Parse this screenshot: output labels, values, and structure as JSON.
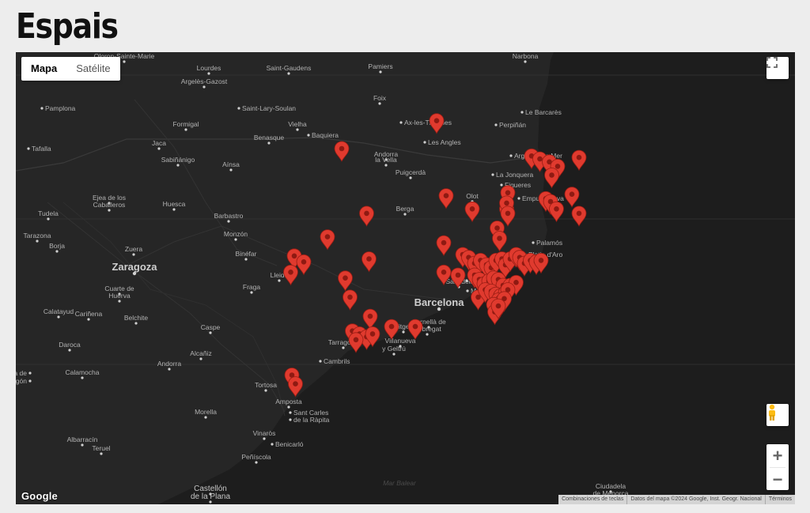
{
  "page": {
    "title": "Espais"
  },
  "map": {
    "map_type_options": [
      {
        "label": "Mapa",
        "active": true
      },
      {
        "label": "Satélite",
        "active": false
      }
    ],
    "zoom_in_label": "+",
    "zoom_out_label": "−",
    "google_logo": "Google",
    "attribution": [
      "Combinaciones de teclas",
      "Datos del mapa ©2024 Google, Inst. Geogr. Nacional",
      "Términos"
    ],
    "marker_color": "#e03a2e",
    "places": [
      {
        "name": "Oloron-Sainte-Marie",
        "type": "town"
      },
      {
        "name": "Lourdes",
        "type": "town"
      },
      {
        "name": "Saint-Gaudens",
        "type": "town"
      },
      {
        "name": "Pamiers",
        "type": "town"
      },
      {
        "name": "Narbona",
        "type": "town"
      },
      {
        "name": "Argelès-Gazost",
        "type": "town"
      },
      {
        "name": "Foix",
        "type": "town"
      },
      {
        "name": "Pamplona",
        "type": "town"
      },
      {
        "name": "Saint-Lary-Soulan",
        "type": "town"
      },
      {
        "name": "Le Barcarès",
        "type": "town"
      },
      {
        "name": "Formigal",
        "type": "town"
      },
      {
        "name": "Vielha",
        "type": "town"
      },
      {
        "name": "Ax-les-Thermes",
        "type": "town"
      },
      {
        "name": "Perpiñán",
        "type": "town"
      },
      {
        "name": "Benasque",
        "type": "town"
      },
      {
        "name": "Baquiera",
        "type": "town"
      },
      {
        "name": "Jaca",
        "type": "town"
      },
      {
        "name": "Les Angles",
        "type": "town"
      },
      {
        "name": "Tafalla",
        "type": "town"
      },
      {
        "name": "Andorra",
        "type": "town"
      },
      {
        "name": "la Vella",
        "type": "town"
      },
      {
        "name": "Argelès-sur-Mer",
        "type": "town"
      },
      {
        "name": "Sabiñánigo",
        "type": "town"
      },
      {
        "name": "Aínsa",
        "type": "town"
      },
      {
        "name": "Puigcerdà",
        "type": "town"
      },
      {
        "name": "La Jonquera",
        "type": "town"
      },
      {
        "name": "Figueres",
        "type": "town"
      },
      {
        "name": "Olot",
        "type": "town"
      },
      {
        "name": "Empuriabrava",
        "type": "town"
      },
      {
        "name": "Ejea de los",
        "type": "town"
      },
      {
        "name": "Caballeros",
        "type": "town"
      },
      {
        "name": "Huesca",
        "type": "town"
      },
      {
        "name": "Tudela",
        "type": "town"
      },
      {
        "name": "Berga",
        "type": "town"
      },
      {
        "name": "Barbastro",
        "type": "town"
      },
      {
        "name": "Tarazona",
        "type": "town"
      },
      {
        "name": "Borja",
        "type": "town"
      },
      {
        "name": "Monzón",
        "type": "town"
      },
      {
        "name": "Palamós",
        "type": "town"
      },
      {
        "name": "Zuera",
        "type": "town"
      },
      {
        "name": "Binéfar",
        "type": "town"
      },
      {
        "name": "Platja d'Aro",
        "type": "town"
      },
      {
        "name": "Zaragoza",
        "type": "city"
      },
      {
        "name": "Lleida",
        "type": "town"
      },
      {
        "name": "de Mar",
        "type": "town"
      },
      {
        "name": "Fraga",
        "type": "town"
      },
      {
        "name": "Cuarte de",
        "type": "town"
      },
      {
        "name": "Huerva",
        "type": "town"
      },
      {
        "name": "Sabadell",
        "type": "town"
      },
      {
        "name": "Mollet",
        "type": "town"
      },
      {
        "name": "Mataró",
        "type": "town"
      },
      {
        "name": "Barcelona",
        "type": "city"
      },
      {
        "name": "Calatayud",
        "type": "town"
      },
      {
        "name": "Cariñena",
        "type": "town"
      },
      {
        "name": "Belchite",
        "type": "town"
      },
      {
        "name": "Caspe",
        "type": "town"
      },
      {
        "name": "Sitges",
        "type": "town"
      },
      {
        "name": "Cornellà de",
        "type": "town"
      },
      {
        "name": "Llobregat",
        "type": "town"
      },
      {
        "name": "Tarragona",
        "type": "town"
      },
      {
        "name": "Villanueva",
        "type": "town"
      },
      {
        "name": "y Geltrú",
        "type": "town"
      },
      {
        "name": "Daroca",
        "type": "town"
      },
      {
        "name": "Alcañiz",
        "type": "town"
      },
      {
        "name": "Andorra",
        "type": "town"
      },
      {
        "name": "Cambrils",
        "type": "town"
      },
      {
        "name": "Molina de",
        "type": "town"
      },
      {
        "name": "Aragón",
        "type": "town"
      },
      {
        "name": "Calamocha",
        "type": "town"
      },
      {
        "name": "Tortosa",
        "type": "town"
      },
      {
        "name": "Amposta",
        "type": "town"
      },
      {
        "name": "Morella",
        "type": "town"
      },
      {
        "name": "Sant Carles",
        "type": "town"
      },
      {
        "name": "de la Ràpita",
        "type": "town"
      },
      {
        "name": "Vinaròs",
        "type": "town"
      },
      {
        "name": "Albarracín",
        "type": "town"
      },
      {
        "name": "Benicarló",
        "type": "town"
      },
      {
        "name": "Teruel",
        "type": "town"
      },
      {
        "name": "Peñíscola",
        "type": "town"
      },
      {
        "name": "Mar Balear",
        "type": "water"
      },
      {
        "name": "Castellón",
        "type": "city2"
      },
      {
        "name": "de la Plana",
        "type": "city2"
      },
      {
        "name": "Ciudadela",
        "type": "town"
      },
      {
        "name": "de Menorca",
        "type": "town"
      }
    ],
    "markers": [
      {
        "lon": 1.78,
        "lat": 42.55
      },
      {
        "lon": 0.98,
        "lat": 42.36
      },
      {
        "lon": 2.58,
        "lat": 42.31
      },
      {
        "lon": 2.65,
        "lat": 42.29
      },
      {
        "lon": 2.73,
        "lat": 42.27
      },
      {
        "lon": 2.8,
        "lat": 42.24
      },
      {
        "lon": 2.98,
        "lat": 42.3
      },
      {
        "lon": 2.75,
        "lat": 42.18
      },
      {
        "lon": 2.7,
        "lat": 42.02
      },
      {
        "lon": 2.74,
        "lat": 42.0
      },
      {
        "lon": 2.79,
        "lat": 41.95
      },
      {
        "lon": 2.92,
        "lat": 42.05
      },
      {
        "lon": 2.98,
        "lat": 41.92
      },
      {
        "lon": 1.86,
        "lat": 42.04
      },
      {
        "lon": 2.08,
        "lat": 41.95
      },
      {
        "lon": 2.37,
        "lat": 41.95
      },
      {
        "lon": 2.38,
        "lat": 42.06
      },
      {
        "lon": 2.37,
        "lat": 41.99
      },
      {
        "lon": 2.38,
        "lat": 41.92
      },
      {
        "lon": 1.19,
        "lat": 41.92
      },
      {
        "lon": 0.86,
        "lat": 41.76
      },
      {
        "lon": 2.29,
        "lat": 41.82
      },
      {
        "lon": 2.31,
        "lat": 41.75
      },
      {
        "lon": 1.84,
        "lat": 41.72
      },
      {
        "lon": 1.21,
        "lat": 41.61
      },
      {
        "lon": 0.58,
        "lat": 41.63
      },
      {
        "lon": 0.66,
        "lat": 41.59
      },
      {
        "lon": 0.55,
        "lat": 41.52
      },
      {
        "lon": 1.01,
        "lat": 41.48
      },
      {
        "lon": 1.84,
        "lat": 41.52
      },
      {
        "lon": 1.96,
        "lat": 41.5
      },
      {
        "lon": 2.0,
        "lat": 41.64
      },
      {
        "lon": 2.05,
        "lat": 41.62
      },
      {
        "lon": 2.1,
        "lat": 41.58
      },
      {
        "lon": 2.15,
        "lat": 41.6
      },
      {
        "lon": 2.2,
        "lat": 41.57
      },
      {
        "lon": 2.24,
        "lat": 41.55
      },
      {
        "lon": 2.28,
        "lat": 41.6
      },
      {
        "lon": 2.33,
        "lat": 41.61
      },
      {
        "lon": 2.36,
        "lat": 41.57
      },
      {
        "lon": 2.4,
        "lat": 41.61
      },
      {
        "lon": 2.45,
        "lat": 41.64
      },
      {
        "lon": 2.48,
        "lat": 41.62
      },
      {
        "lon": 2.52,
        "lat": 41.58
      },
      {
        "lon": 2.57,
        "lat": 41.6
      },
      {
        "lon": 2.62,
        "lat": 41.59
      },
      {
        "lon": 2.66,
        "lat": 41.6
      },
      {
        "lon": 2.1,
        "lat": 41.5
      },
      {
        "lon": 2.14,
        "lat": 41.47
      },
      {
        "lon": 2.18,
        "lat": 41.44
      },
      {
        "lon": 2.22,
        "lat": 41.46
      },
      {
        "lon": 2.26,
        "lat": 41.48
      },
      {
        "lon": 2.3,
        "lat": 41.47
      },
      {
        "lon": 2.34,
        "lat": 41.43
      },
      {
        "lon": 2.4,
        "lat": 41.43
      },
      {
        "lon": 2.45,
        "lat": 41.45
      },
      {
        "lon": 2.13,
        "lat": 41.35
      },
      {
        "lon": 2.19,
        "lat": 41.4
      },
      {
        "lon": 2.24,
        "lat": 41.39
      },
      {
        "lon": 2.28,
        "lat": 41.37
      },
      {
        "lon": 2.32,
        "lat": 41.36
      },
      {
        "lon": 2.36,
        "lat": 41.38
      },
      {
        "lon": 2.38,
        "lat": 41.4
      },
      {
        "lon": 2.3,
        "lat": 41.33
      },
      {
        "lon": 2.33,
        "lat": 41.32
      },
      {
        "lon": 2.35,
        "lat": 41.34
      },
      {
        "lon": 2.26,
        "lat": 41.3
      },
      {
        "lon": 2.27,
        "lat": 41.25
      },
      {
        "lon": 2.3,
        "lat": 41.29
      },
      {
        "lon": 1.05,
        "lat": 41.35
      },
      {
        "lon": 1.22,
        "lat": 41.22
      },
      {
        "lon": 1.07,
        "lat": 41.12
      },
      {
        "lon": 1.13,
        "lat": 41.1
      },
      {
        "lon": 1.19,
        "lat": 41.08
      },
      {
        "lon": 1.24,
        "lat": 41.1
      },
      {
        "lon": 1.1,
        "lat": 41.06
      },
      {
        "lon": 1.4,
        "lat": 41.15
      },
      {
        "lon": 1.6,
        "lat": 41.15
      },
      {
        "lon": 0.56,
        "lat": 40.82
      },
      {
        "lon": 0.59,
        "lat": 40.76
      }
    ]
  }
}
